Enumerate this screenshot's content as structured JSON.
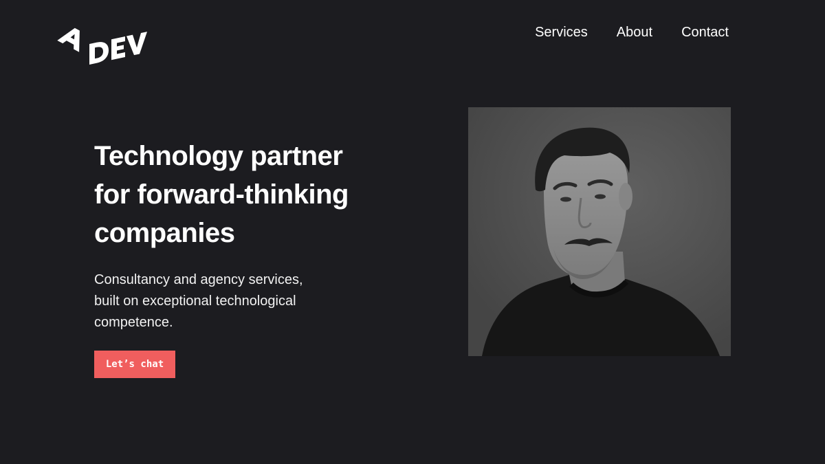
{
  "header": {
    "logo": {
      "icon": "adev-logo",
      "text": "A DEV"
    },
    "nav": [
      {
        "label": "Services"
      },
      {
        "label": "About"
      },
      {
        "label": "Contact"
      }
    ]
  },
  "hero": {
    "title_lines": [
      "Technology partner",
      "for forward-thinking",
      "companies"
    ],
    "subtitle_lines": [
      "Consultancy and agency services,",
      "built on exceptional technological",
      "competence."
    ],
    "cta_label": "Let’s  chat",
    "image": {
      "icon": "portrait-photo",
      "style": "black-and-white"
    }
  },
  "colors": {
    "background": "#1c1c20",
    "text": "#ffffff",
    "accent": "#f05e5e"
  }
}
